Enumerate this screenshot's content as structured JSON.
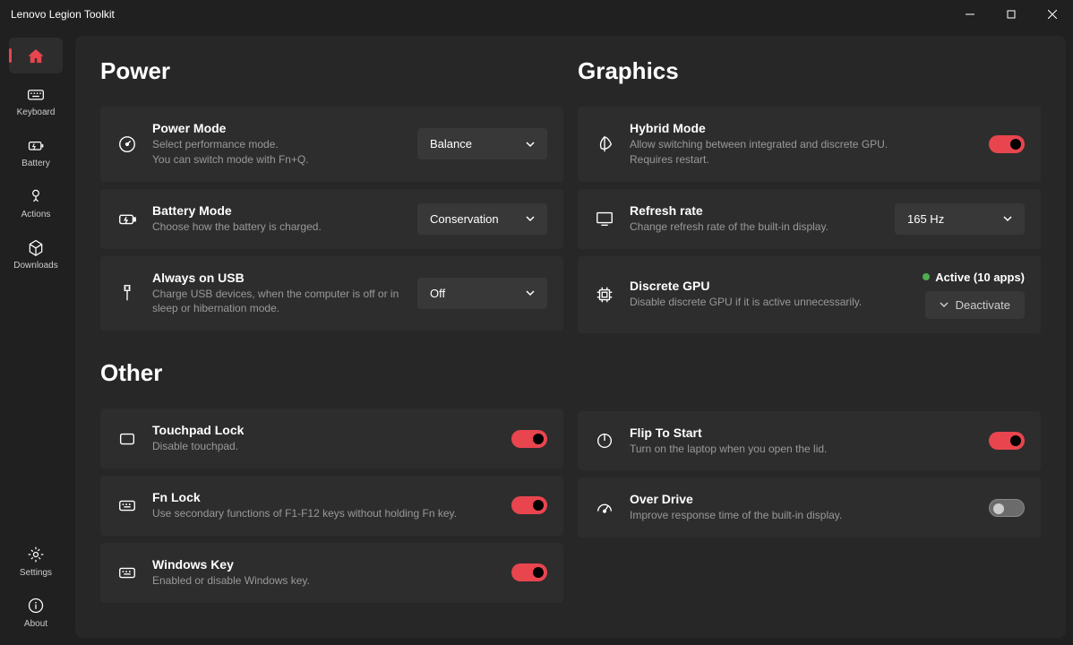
{
  "titlebar": {
    "title": "Lenovo Legion Toolkit"
  },
  "sidebar": {
    "items": [
      {
        "label": ""
      },
      {
        "label": "Keyboard"
      },
      {
        "label": "Battery"
      },
      {
        "label": "Actions"
      },
      {
        "label": "Downloads"
      }
    ],
    "bottom": [
      {
        "label": "Settings"
      },
      {
        "label": "About"
      }
    ]
  },
  "sections": {
    "power": {
      "title": "Power",
      "powerMode": {
        "title": "Power Mode",
        "desc1": "Select performance mode.",
        "desc2": "You can switch mode with Fn+Q.",
        "value": "Balance"
      },
      "batteryMode": {
        "title": "Battery Mode",
        "desc": "Choose how the battery is charged.",
        "value": "Conservation"
      },
      "alwaysOnUsb": {
        "title": "Always on USB",
        "desc": "Charge USB devices, when the computer is off or in sleep or hibernation mode.",
        "value": "Off"
      }
    },
    "graphics": {
      "title": "Graphics",
      "hybridMode": {
        "title": "Hybrid Mode",
        "desc1": "Allow switching between integrated and discrete GPU.",
        "desc2": "Requires restart."
      },
      "refreshRate": {
        "title": "Refresh rate",
        "desc": "Change refresh rate of the built-in display.",
        "value": "165 Hz"
      },
      "discreteGpu": {
        "title": "Discrete GPU",
        "desc": "Disable discrete GPU if it is active unnecessarily.",
        "status": "Active (10 apps)",
        "button": "Deactivate"
      }
    },
    "other": {
      "title": "Other",
      "touchpadLock": {
        "title": "Touchpad Lock",
        "desc": "Disable touchpad."
      },
      "fnLock": {
        "title": "Fn Lock",
        "desc": "Use secondary functions of F1-F12 keys without holding Fn key."
      },
      "windowsKey": {
        "title": "Windows Key",
        "desc": "Enabled or disable Windows key."
      },
      "flipToStart": {
        "title": "Flip To Start",
        "desc": "Turn on the laptop when you open the lid."
      },
      "overDrive": {
        "title": "Over Drive",
        "desc": "Improve response time of the built-in display."
      }
    }
  }
}
